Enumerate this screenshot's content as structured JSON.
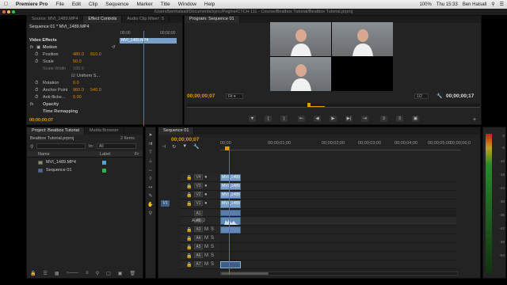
{
  "menubar": {
    "apple": "",
    "app_name": "Premiere Pro",
    "items": [
      "File",
      "Edit",
      "Clip",
      "Sequence",
      "Marker",
      "Title",
      "Window",
      "Help"
    ],
    "battery": "100%",
    "time": "Thu 15:33",
    "user": "Ben Halsall"
  },
  "window": {
    "path": "/Users/benhalsall/Documents/sync/Pegine/CTCH 111 - Course/Beatbox Tutorial/Beatbox Tutorial.prproj"
  },
  "source_panel": {
    "tabs": [
      "Source: MVI_1489.MP4",
      "Effect Controls",
      "Audio Clip Mixer: S"
    ],
    "clip_title": "Sequence 01 * MVI_1489.MP4",
    "ruler_start": "00;00",
    "ruler_end": "00;00;00",
    "clip_label": "MVI_1489.MP4",
    "video_effects": "Video Effects",
    "motion": "Motion",
    "position_label": "Position",
    "position_x": "480.0",
    "position_y": "810.0",
    "scale_label": "Scale",
    "scale_value": "50.0",
    "scale_width_label": "Scale Width",
    "scale_width_value": "100.0",
    "uniform_scale": "Uniform S...",
    "rotation_label": "Rotation",
    "rotation_value": "0.0",
    "anchor_label": "Anchor Point",
    "anchor_x": "960.0",
    "anchor_y": "540.0",
    "antiflicker_label": "Anti-flicke...",
    "antiflicker_value": "0.00",
    "opacity_label": "Opacity",
    "timeremap_label": "Time Remapping",
    "timecode": "00;00;00;07"
  },
  "program": {
    "tab": "Program: Sequence 01",
    "timecode": "00;00;00;07",
    "fit": "Fit",
    "fraction": "1/2",
    "duration": "00;00;00;17"
  },
  "project": {
    "tabs": [
      "Project: Beatbox Tutorial",
      "Media Browser"
    ],
    "file": "Beatbox Tutorial.prproj",
    "items_count": "2 Items",
    "in_label": "In:",
    "in_value": "All",
    "col_name": "Name",
    "col_label": "Label",
    "col_fr": "Fr",
    "items": [
      {
        "name": "MVI_1489.MP4",
        "color": "#4da6d8"
      },
      {
        "name": "Sequence 01",
        "color": "#2fb24a"
      }
    ]
  },
  "timeline": {
    "tab": "Sequence 01",
    "timecode": "00;00;00;07",
    "ruler": [
      "00;00",
      "00;00;01;00",
      "00;00;02;00",
      "00;00;03;00",
      "00;00;04;00",
      "00;00;05;00",
      "00;00;06;0"
    ],
    "video_tracks": [
      {
        "label": "V4",
        "clip": "MVI_1489"
      },
      {
        "label": "V3",
        "clip": "MVI_1489"
      },
      {
        "label": "V2",
        "clip": "MVI_1489"
      },
      {
        "label": "V1",
        "clip": "MVI_1489",
        "source": "V1"
      }
    ],
    "audio_tracks": [
      "A1",
      "A2",
      "A3",
      "A4",
      "A5",
      "A6",
      "A7"
    ],
    "a2_name": "Audio 2",
    "meter_ticks": [
      "0",
      "-6",
      "-12",
      "-18",
      "-24",
      "-30",
      "-36",
      "-42",
      "-48",
      "-54"
    ]
  },
  "colors": {
    "accent": "#e89b00",
    "playhead": "#e04040",
    "video_clip": "#7aa0c8",
    "audio_clip": "#6289b5"
  }
}
